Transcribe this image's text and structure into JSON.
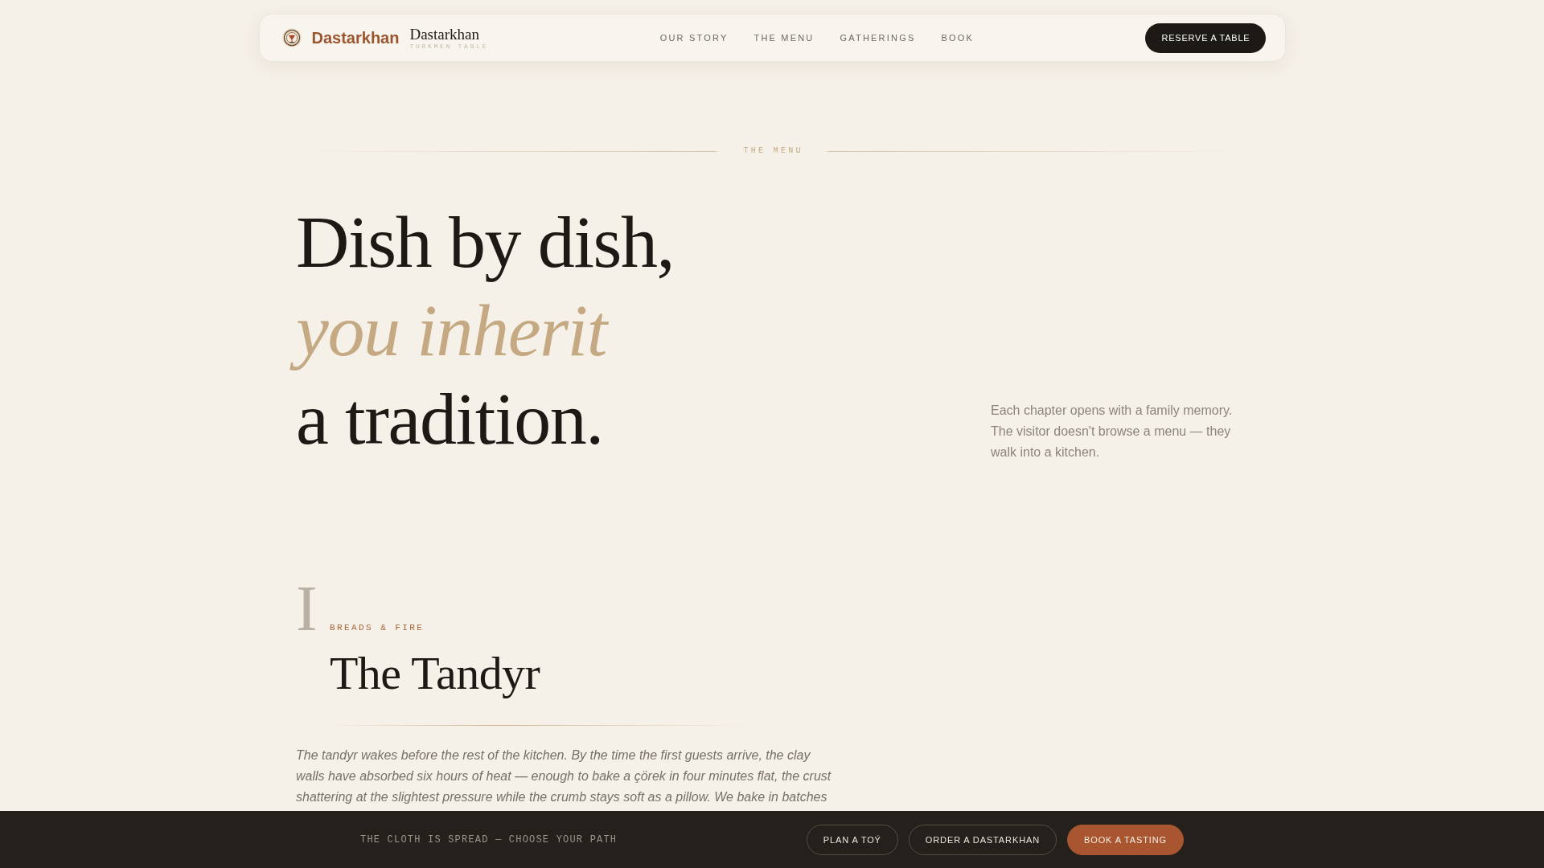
{
  "nav": {
    "brand": "Dastarkhan",
    "wordmark": "Dastarkhan",
    "tagline": "TURKMEN TABLE",
    "links": [
      {
        "label": "OUR STORY"
      },
      {
        "label": "THE MENU"
      },
      {
        "label": "GATHERINGS"
      },
      {
        "label": "BOOK"
      }
    ],
    "cta": "RESERVE A TABLE"
  },
  "section_label": "THE MENU",
  "hero": {
    "headline": [
      {
        "text": "Dish by dish,",
        "kind": "plain"
      },
      {
        "text": "you inherit",
        "kind": "accent"
      },
      {
        "text": "a tradition.",
        "kind": "plain"
      }
    ],
    "intro": "Each chapter opens with a family memory. The visitor doesn't browse a menu — they walk into a kitchen."
  },
  "chapter": {
    "numeral": "I",
    "eyebrow": "BREADS & FIRE",
    "title": "The Tandyr",
    "body": "The tandyr wakes before the rest of the kitchen. By the time the first guests arrive, the clay walls have absorbed six hours of heat — enough to bake a çörek in four minutes flat, the crust shattering at the slightest pressure while the crumb stays soft as a pillow. We bake in batches"
  },
  "bottom_bar": {
    "tagline": "THE CLOTH IS SPREAD — CHOOSE YOUR PATH",
    "buttons": [
      {
        "label": "PLAN A TOÝ",
        "kind": "outline"
      },
      {
        "label": "ORDER A DASTARKHAN",
        "kind": "outline"
      },
      {
        "label": "BOOK A TASTING",
        "kind": "primary"
      }
    ]
  }
}
